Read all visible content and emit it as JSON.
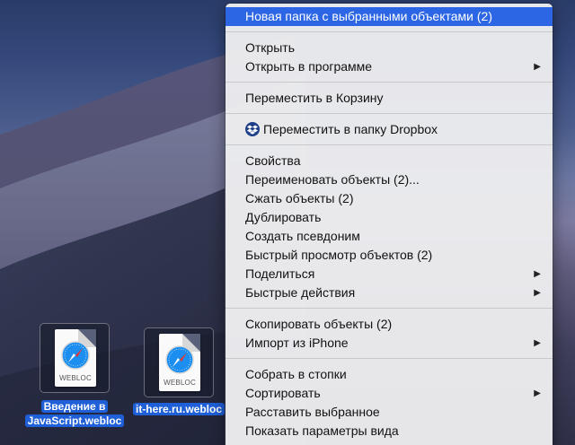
{
  "context_menu": {
    "groups": [
      [
        {
          "label": "Новая папка с выбранными объектами (2)",
          "highlighted": true
        }
      ],
      [
        {
          "label": "Открыть"
        },
        {
          "label": "Открыть в программе",
          "submenu": true
        }
      ],
      [
        {
          "label": "Переместить в Корзину"
        }
      ],
      [
        {
          "label": "Переместить в папку Dropbox",
          "icon": "dropbox-icon"
        }
      ],
      [
        {
          "label": "Свойства"
        },
        {
          "label": "Переименовать объекты (2)..."
        },
        {
          "label": "Сжать объекты (2)"
        },
        {
          "label": "Дублировать"
        },
        {
          "label": "Создать псевдоним"
        },
        {
          "label": "Быстрый просмотр объектов (2)"
        },
        {
          "label": "Поделиться",
          "submenu": true
        },
        {
          "label": "Быстрые действия",
          "submenu": true
        }
      ],
      [
        {
          "label": "Скопировать объекты (2)"
        },
        {
          "label": "Импорт из iPhone",
          "submenu": true
        }
      ],
      [
        {
          "label": "Собрать в стопки"
        },
        {
          "label": "Сортировать",
          "submenu": true
        },
        {
          "label": "Расставить выбранное"
        },
        {
          "label": "Показать параметры вида"
        }
      ]
    ],
    "submenu_arrow": "▶"
  },
  "desktop_files": [
    {
      "label_lines": [
        "Введение в",
        "JavaScript.webloc"
      ],
      "ext": "WEBLOC",
      "icon": "safari-compass-icon"
    },
    {
      "label_lines": [
        "it-here.ru.webloc"
      ],
      "ext": "WEBLOC",
      "icon": "safari-compass-icon"
    }
  ],
  "colors": {
    "highlight": "#2c66e5",
    "selection_label": "#1f5fd8",
    "menu_bg": "#ececee"
  }
}
